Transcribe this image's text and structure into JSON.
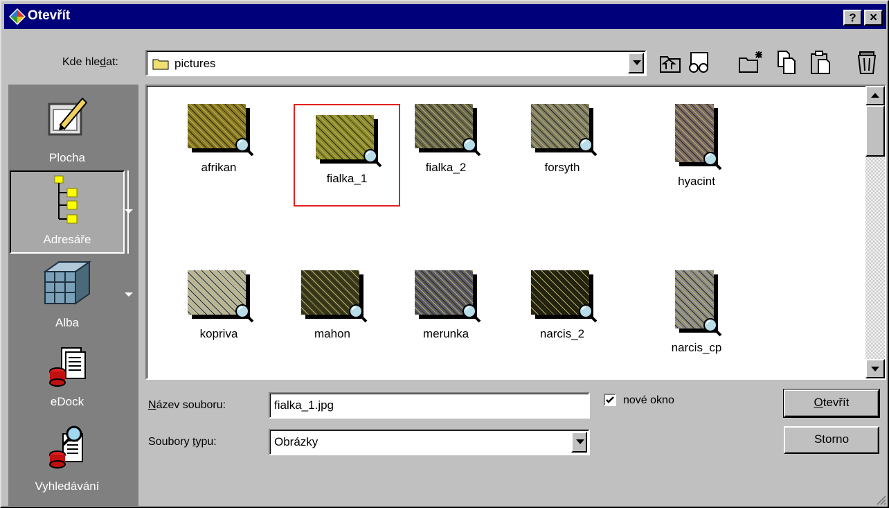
{
  "window": {
    "title": "Otevřít",
    "help_label": "?",
    "close_label": "✕"
  },
  "look_in": {
    "label": "Kde hledat:",
    "value": "pictures"
  },
  "toolbar": {
    "icons": [
      "up-folder-icon",
      "preview-icon",
      "new-folder-icon",
      "list-view-icon",
      "details-view-icon",
      "delete-icon"
    ]
  },
  "places": [
    {
      "label": "Plocha",
      "icon": "desktop-icon"
    },
    {
      "label": "Adresáře",
      "icon": "folders-tree-icon",
      "selected": true
    },
    {
      "label": "Alba",
      "icon": "albums-icon"
    },
    {
      "label": "eDock",
      "icon": "edock-icon"
    },
    {
      "label": "Vyhledávání",
      "icon": "search-icon"
    }
  ],
  "files": [
    {
      "name": "afrikan",
      "color": "#8a7a20"
    },
    {
      "name": "fialka_1",
      "color": "#8c8c2a",
      "selected": true
    },
    {
      "name": "fialka_2",
      "color": "#6a6a52"
    },
    {
      "name": "forsyth",
      "color": "#7e7e6a"
    },
    {
      "name": "hyacint",
      "color": "#7a6a6a"
    },
    {
      "name": "kopriva",
      "color": "#b8b8a8"
    },
    {
      "name": "mahon",
      "color": "#3a3a1e"
    },
    {
      "name": "merunka",
      "color": "#5a5a6a"
    },
    {
      "name": "narcis_2",
      "color": "#202010"
    },
    {
      "name": "narcis_cp",
      "color": "#8c8c8c"
    }
  ],
  "filename": {
    "label": "Název souboru:",
    "value": "fialka_1.jpg"
  },
  "filetype": {
    "label": "Soubory typu:",
    "value": "Obrázky"
  },
  "new_window": {
    "label": "nové okno",
    "checked": true
  },
  "buttons": {
    "open": "Otevřít",
    "cancel": "Storno"
  }
}
